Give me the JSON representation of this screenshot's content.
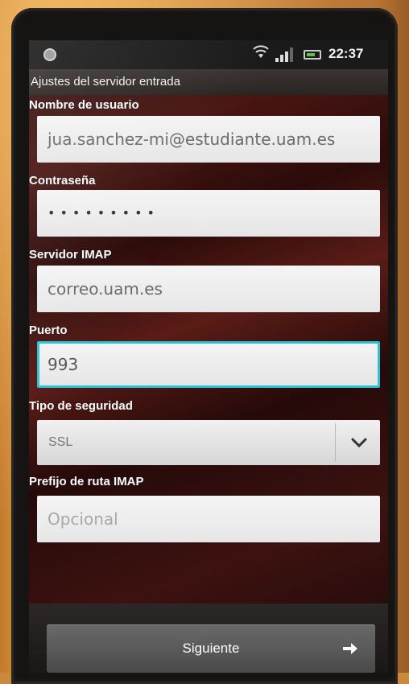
{
  "status_bar": {
    "time": "22:37",
    "icons": [
      "app-notification-icon",
      "wifi-icon",
      "signal-icon",
      "battery-icon"
    ]
  },
  "screen": {
    "title": "Ajustes del servidor entrada"
  },
  "form": {
    "username": {
      "label": "Nombre de usuario",
      "value": "jua.sanchez-mi@estudiante.uam.es"
    },
    "password": {
      "label": "Contraseña",
      "value": "•••••••••"
    },
    "imap_server": {
      "label": "Servidor IMAP",
      "value": "correo.uam.es"
    },
    "port": {
      "label": "Puerto",
      "value": "993"
    },
    "security_type": {
      "label": "Tipo de seguridad",
      "value": "SSL"
    },
    "imap_path_prefix": {
      "label": "Prefijo de ruta IMAP",
      "value": "",
      "placeholder": "Opcional"
    }
  },
  "actions": {
    "next_label": "Siguiente"
  },
  "colors": {
    "focus_accent": "#29c2d6",
    "battery_green": "#5fc23a"
  }
}
